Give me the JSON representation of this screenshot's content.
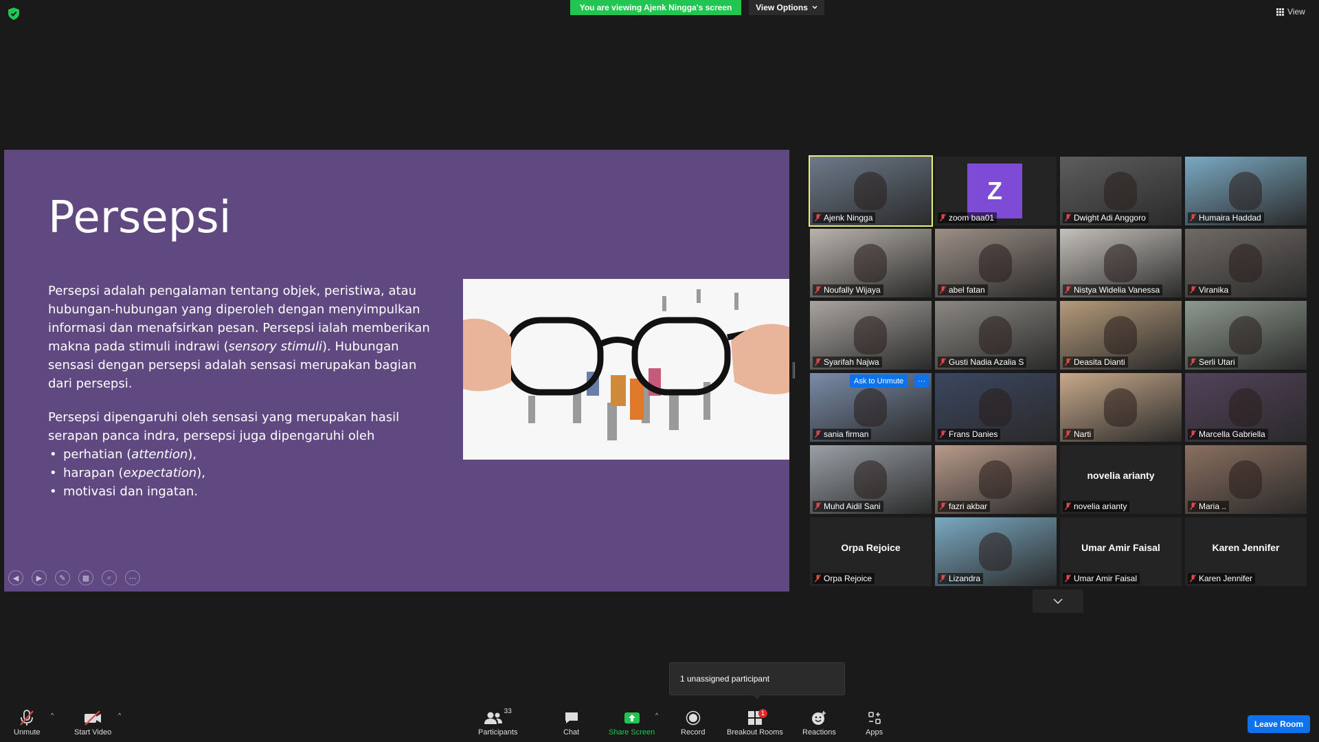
{
  "top": {
    "banner": "You are viewing Ajenk Ningga's screen",
    "view_options": "View Options",
    "view": "View"
  },
  "slide": {
    "title": "Persepsi",
    "p1_a": "Persepsi adalah pengalaman tentang objek, peristiwa, atau hubungan-hubungan yang diperoleh dengan menyimpulkan informasi dan menafsirkan pesan. Persepsi ialah memberikan makna pada stimuli indrawi (",
    "p1_italic": "sensory stimuli",
    "p1_b": "). Hubungan sensasi dengan persepsi adalah sensasi merupakan bagian dari persepsi.",
    "p2": "Persepsi dipengaruhi oleh sensasi yang merupakan hasil serapan panca indra, persepsi juga dipengaruhi oleh",
    "bullets": [
      {
        "pre": "perhatian (",
        "it": "attention",
        "post": "),"
      },
      {
        "pre": "harapan (",
        "it": "expectation",
        "post": "),"
      },
      {
        "pre": "motivasi dan ingatan.",
        "it": "",
        "post": ""
      }
    ]
  },
  "participants": [
    {
      "name": "Ajenk Ningga",
      "active": true
    },
    {
      "name": "zoom baa01",
      "avatar": "Z"
    },
    {
      "name": "Dwight Adi Anggoro"
    },
    {
      "name": "Humaira Haddad"
    },
    {
      "name": "Noufally Wijaya"
    },
    {
      "name": "abel fatan"
    },
    {
      "name": "Nistya Widelia Vanessa"
    },
    {
      "name": "Viranika"
    },
    {
      "name": "Syarifah Najwa"
    },
    {
      "name": "Gusti Nadia Azalia S"
    },
    {
      "name": "Deasita Dianti"
    },
    {
      "name": "Serli Utari"
    },
    {
      "name": "sania firman"
    },
    {
      "name": "Frans Danies"
    },
    {
      "name": "Narti"
    },
    {
      "name": "Marcella Gabriella"
    },
    {
      "name": "Muhd Aidil Sani"
    },
    {
      "name": "fazri akbar"
    },
    {
      "name": "novelia arianty",
      "big": "novelia arianty"
    },
    {
      "name": "Maria .."
    },
    {
      "name": "Orpa Rejoice",
      "big": "Orpa Rejoice"
    },
    {
      "name": "Lizandra"
    },
    {
      "name": "Umar Amir Faisal",
      "big": "Umar Amir Faisal"
    },
    {
      "name": "Karen Jennifer",
      "big": "Karen Jennifer"
    }
  ],
  "ask_unmute": "Ask to Unmute",
  "ask_more": "···",
  "tooltip": "1 unassigned participant",
  "toolbar": {
    "unmute": "Unmute",
    "start_video": "Start Video",
    "participants": "Participants",
    "participants_count": "33",
    "chat": "Chat",
    "share_screen": "Share Screen",
    "record": "Record",
    "breakout_rooms": "Breakout Rooms",
    "breakout_badge": "1",
    "reactions": "Reactions",
    "apps": "Apps",
    "leave": "Leave Room"
  },
  "colors": {
    "slide_bg": "#5f4980",
    "banner": "#23c552",
    "accent_blue": "#0e72ed",
    "active_speaker": "#e8f27a"
  }
}
